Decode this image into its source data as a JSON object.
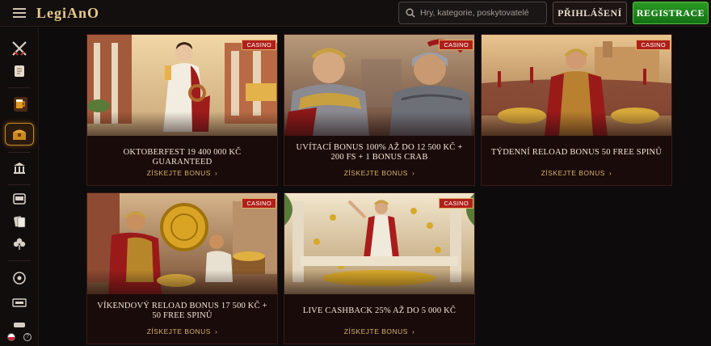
{
  "header": {
    "logo": "LegiAnO",
    "search_placeholder": "Hry, kategorie, poskytovatelé",
    "login_label": "PŘIHLÁŠENÍ",
    "register_label": "REGISTRACE"
  },
  "sidebar": {
    "items": [
      {
        "icon": "crossed-swords-icon"
      },
      {
        "icon": "scroll-icon"
      },
      {
        "icon": "beer-mug-icon"
      },
      {
        "icon": "treasure-chest-icon",
        "active": true
      },
      {
        "icon": "bank-icon"
      },
      {
        "icon": "slot-machine-icon"
      },
      {
        "icon": "cards-icon"
      },
      {
        "icon": "clover-icon"
      },
      {
        "icon": "roulette-icon"
      },
      {
        "icon": "live-icon"
      },
      {
        "icon": "more-icon"
      }
    ],
    "language_icon": "czech-flag-icon",
    "help_icon": "question-icon"
  },
  "promotions": [
    {
      "badge": "CASINO",
      "title": "OKTOBERFEST 19 400 000 KČ GUARANTEED",
      "cta": "ZÍSKEJTE BONUS"
    },
    {
      "badge": "CASINO",
      "title": "UVÍTACÍ BONUS 100% AŽ DO 12 500 KČ + 200 FS + 1 BONUS CRAB",
      "cta": "ZÍSKEJTE BONUS"
    },
    {
      "badge": "CASINO",
      "title": "TÝDENNÍ RELOAD BONUS 50 FREE SPINŮ",
      "cta": "ZÍSKEJTE BONUS"
    },
    {
      "badge": "CASINO",
      "title": "VÍKENDOVÝ RELOAD BONUS 17 500 KČ + 50 FREE SPINŮ",
      "cta": "ZÍSKEJTE BONUS"
    },
    {
      "badge": "CASINO",
      "title": "LIVE CASHBACK 25% AŽ DO 5 000 KČ",
      "cta": "ZÍSKEJTE BONUS"
    }
  ],
  "colors": {
    "accent_gold": "#d8b26a",
    "badge_red": "#b0201a",
    "register_green": "#1f8a1c"
  }
}
